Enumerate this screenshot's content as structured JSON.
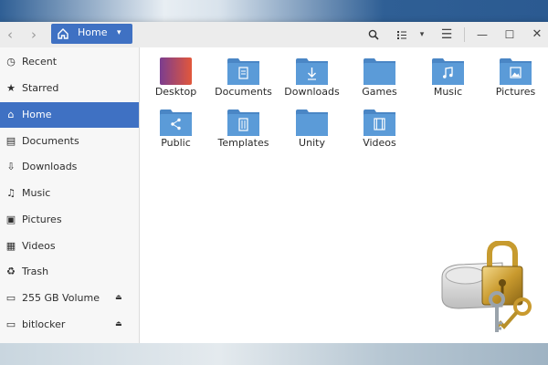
{
  "header": {
    "back_icon": "chevron-left-icon",
    "forward_icon": "chevron-right-icon",
    "path_label": "Home",
    "path_caret": "▾",
    "view_caret": "▾",
    "menu_glyph": "☰",
    "min_glyph": "—",
    "max_glyph": "☐",
    "close_glyph": "✕"
  },
  "sidebar": {
    "items": [
      {
        "label": "Recent",
        "icon": "clock-icon",
        "glyph": "◷"
      },
      {
        "label": "Starred",
        "icon": "star-icon",
        "glyph": "★"
      },
      {
        "label": "Home",
        "icon": "home-icon",
        "glyph": "⌂",
        "active": true
      },
      {
        "label": "Documents",
        "icon": "document-icon",
        "glyph": "▤"
      },
      {
        "label": "Downloads",
        "icon": "download-icon",
        "glyph": "⇩"
      },
      {
        "label": "Music",
        "icon": "music-icon",
        "glyph": "♫"
      },
      {
        "label": "Pictures",
        "icon": "picture-icon",
        "glyph": "▣"
      },
      {
        "label": "Videos",
        "icon": "video-icon",
        "glyph": "▦"
      },
      {
        "label": "Trash",
        "icon": "trash-icon",
        "glyph": "♻"
      },
      {
        "label": "255 GB Volume",
        "icon": "drive-icon",
        "glyph": "▭",
        "eject": "⏏"
      },
      {
        "label": "bitlocker",
        "icon": "drive-icon",
        "glyph": "▭",
        "eject": "⏏"
      }
    ]
  },
  "files": [
    {
      "label": "Desktop",
      "icon": "desktop-folder-icon"
    },
    {
      "label": "Documents",
      "icon": "documents-folder-icon"
    },
    {
      "label": "Downloads",
      "icon": "downloads-folder-icon"
    },
    {
      "label": "Games",
      "icon": "folder-icon"
    },
    {
      "label": "Music",
      "icon": "music-folder-icon"
    },
    {
      "label": "Pictures",
      "icon": "pictures-folder-icon"
    },
    {
      "label": "Public",
      "icon": "public-folder-icon"
    },
    {
      "label": "Templates",
      "icon": "templates-folder-icon"
    },
    {
      "label": "Unity",
      "icon": "folder-icon"
    },
    {
      "label": "Videos",
      "icon": "videos-folder-icon"
    }
  ],
  "colors": {
    "accent": "#3f71c3",
    "folder": "#5b9bd8",
    "folder_tab": "#4a86c5"
  }
}
